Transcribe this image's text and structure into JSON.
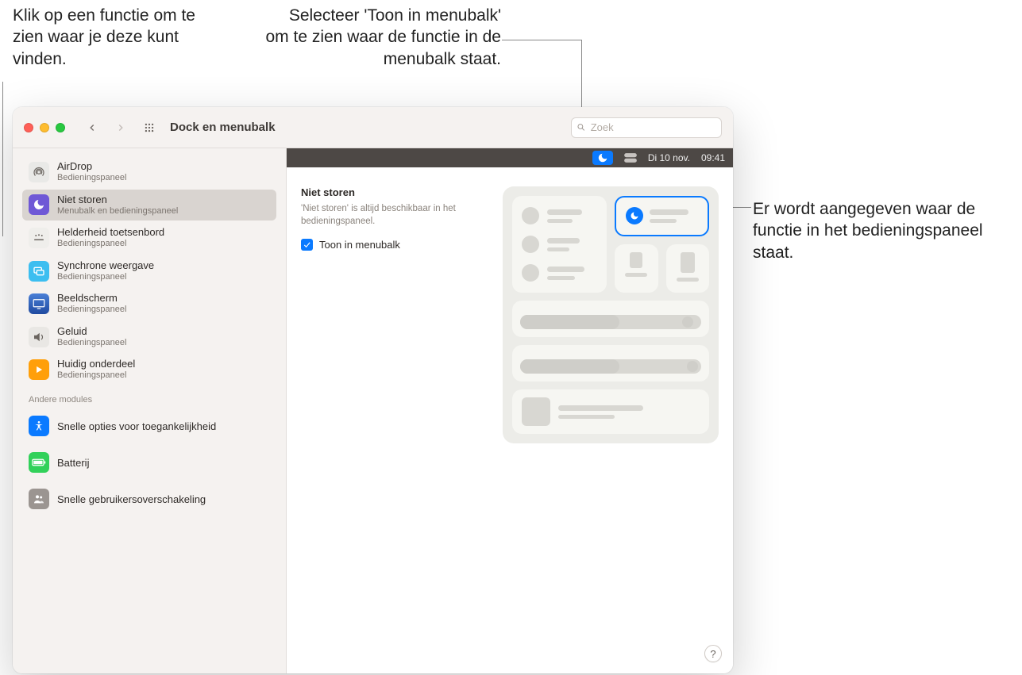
{
  "callouts": {
    "left": "Klik op een functie om te zien waar je deze kunt vinden.",
    "topRight": "Selecteer 'Toon in menubalk' om te zien waar de functie in de menubalk staat.",
    "right": "Er wordt aangegeven waar de functie in het bedieningspaneel staat."
  },
  "window": {
    "title": "Dock en menubalk",
    "searchPlaceholder": "Zoek",
    "helpLabel": "?"
  },
  "miniMenubar": {
    "date": "Di 10 nov.",
    "time": "09:41"
  },
  "sidebar": {
    "items": [
      {
        "title": "AirDrop",
        "sub": "Bedieningspaneel",
        "iconColor": "#e9e9e7",
        "iconName": "airdrop-icon"
      },
      {
        "title": "Niet storen",
        "sub": "Menubalk en bedieningspaneel",
        "iconColor": "#6f58d6",
        "iconName": "moon-icon"
      },
      {
        "title": "Helderheid toetsenbord",
        "sub": "Bedieningspaneel",
        "iconColor": "#efeeeb",
        "iconName": "keyboard-brightness-icon"
      },
      {
        "title": "Synchrone weergave",
        "sub": "Bedieningspaneel",
        "iconColor": "#3cbef0",
        "iconName": "screen-mirroring-icon"
      },
      {
        "title": "Beeldscherm",
        "sub": "Bedieningspaneel",
        "iconColor": "#1f4aa0",
        "iconName": "display-icon"
      },
      {
        "title": "Geluid",
        "sub": "Bedieningspaneel",
        "iconColor": "#d9d6d2",
        "iconName": "sound-icon"
      },
      {
        "title": "Huidig onderdeel",
        "sub": "Bedieningspaneel",
        "iconColor": "#ff9f0a",
        "iconName": "now-playing-icon"
      }
    ],
    "sectionHeader": "Andere modules",
    "otherItems": [
      {
        "title": "Snelle opties voor toegankelijkheid",
        "iconColor": "#0a7aff",
        "iconName": "accessibility-icon"
      },
      {
        "title": "Batterij",
        "iconColor": "#32d15a",
        "iconName": "battery-icon"
      },
      {
        "title": "Snelle gebruikersoverschakeling",
        "iconColor": "#9b9591",
        "iconName": "user-switching-icon"
      }
    ]
  },
  "detail": {
    "heading": "Niet storen",
    "description": "'Niet storen' is altijd beschikbaar in het bedieningspaneel.",
    "checkboxLabel": "Toon in menubalk",
    "checkboxChecked": true
  }
}
